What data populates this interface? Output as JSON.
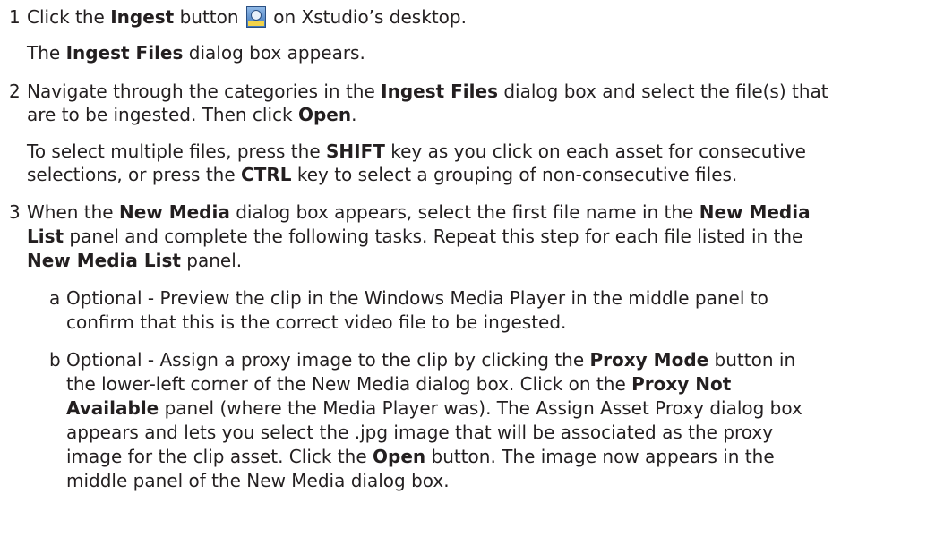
{
  "steps": [
    {
      "number": "1",
      "line1": {
        "pre": "Click the ",
        "b1": "Ingest",
        "mid": " button ",
        "icon": "ingest-icon",
        "post": " on Xstudio’s desktop."
      },
      "note": {
        "pre": "The ",
        "b1": "Ingest Files",
        "post": " dialog box appears."
      }
    },
    {
      "number": "2",
      "line1": {
        "pre": "Navigate through the categories in the ",
        "b1": "Ingest Files",
        "post": " dialog box and select the file(s) that"
      },
      "line2": {
        "pre": "are to be ingested. Then click ",
        "b1": "Open",
        "post": "."
      },
      "note1": {
        "pre": "To select multiple files, press the ",
        "b1": "SHIFT",
        "post": " key as you click on each asset for consecutive"
      },
      "note2": {
        "pre": "selections, or press the ",
        "b1": "CTRL",
        "post": " key to select a grouping of non-consecutive files."
      }
    },
    {
      "number": "3",
      "line1": {
        "pre": "When the ",
        "b1": "New Media",
        "mid": " dialog box appears, select the first file name in the ",
        "b2": "New Media"
      },
      "line2": {
        "b1": "List",
        "post": " panel and complete the following tasks. Repeat this step for each file listed in the"
      },
      "line3": {
        "b1": "New Media List",
        "post": " panel."
      }
    }
  ],
  "substeps": [
    {
      "letter": "a",
      "line1": "Optional - Preview the clip in the Windows Media Player in the middle panel to",
      "line2": "confirm that this is the correct video file to be ingested."
    },
    {
      "letter": "b",
      "line1": {
        "pre": "Optional - Assign a proxy image to the clip by clicking the ",
        "b1": "Proxy Mode",
        "post": " button in"
      },
      "line2": {
        "pre": "the lower-left corner of the New Media dialog box. Click on the ",
        "b1": "Proxy Not"
      },
      "line3": {
        "b1": "Available",
        "post": " panel (where the Media Player was). The Assign Asset Proxy dialog box"
      },
      "line4": "appears and lets you select the .jpg image that will be associated as the proxy",
      "line5": {
        "pre": "image for the clip asset. Click the ",
        "b1": "Open",
        "post": " button. The image now appears in the"
      },
      "line6": "middle panel of the New Media dialog box."
    }
  ]
}
